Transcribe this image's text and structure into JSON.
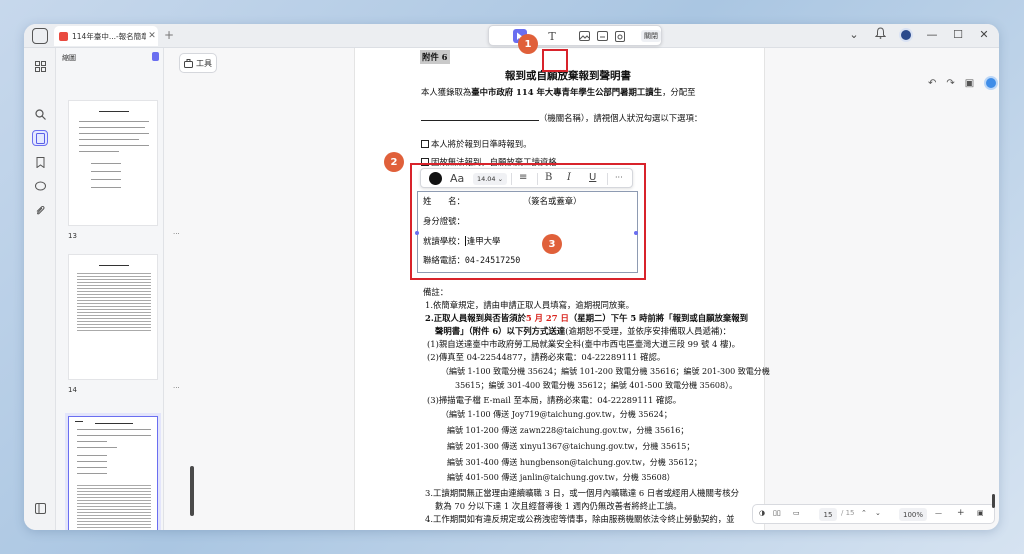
{
  "window": {
    "tab_title": "114年臺中...-報名簡章*",
    "tab_close": "✕",
    "tab_add": "+"
  },
  "titlebar_icons": [
    "chevron-down-icon",
    "bell-icon",
    "avatar",
    "minimize-icon",
    "maximize-icon",
    "close-icon"
  ],
  "titlebar_symbols": {
    "chevron": "⌄",
    "bell": "♪",
    "minimize": "—",
    "maximize": "☐",
    "close": "✕"
  },
  "left_rail": [
    "grid-icon",
    "search-icon",
    "page-edit-icon",
    "bookmark-icon",
    "comment-icon",
    "attachment-icon",
    "layers-icon"
  ],
  "thumbnails": {
    "header": "縮圖",
    "pages": [
      {
        "number": "13",
        "more": "···"
      },
      {
        "number": "14",
        "more": "···"
      },
      {
        "number": "15",
        "more": "···"
      }
    ]
  },
  "tools_button": {
    "label": "工具"
  },
  "edit_toolbar": {
    "close_label": "關閉",
    "text_tool": "T"
  },
  "format_bar": {
    "font_size": "14.04",
    "font_label": "Aa",
    "bold": "B",
    "italic": "I",
    "underline": "U",
    "more": "···"
  },
  "markers": [
    "1",
    "2",
    "3"
  ],
  "document": {
    "attachment": "附件 6",
    "title": "報到或自願放棄報到聲明書",
    "line1_a": "本人獲錄取為",
    "line1_b": "臺中市政府 114 年大專青年學生公部門暑期工讀生",
    "line1_c": "，分配至",
    "line2": "（機關名稱），請視個人狀況勾選以下選項：",
    "option1": "本人將於報到日準時報到。",
    "option2": "因故無法報到，自願放棄工讀資格",
    "form_name": "姓　　名：",
    "form_sign": "（簽名或蓋章）",
    "form_id": "身分證號：",
    "form_school_label": "就讀學校：",
    "form_school_value": "逢甲大學",
    "form_phone_label": "聯絡電話：",
    "form_phone_value": "04-24517250",
    "notes_title": "備註：",
    "note1": "1.依簡章規定，請由申請正取人員填寫，逾期視同放棄。",
    "note2_a": "2.",
    "note2_b": "正取人員報到與否皆須於",
    "note2_date": "5 月 27 日",
    "note2_c": "（星期二）下午 5 時前將「報到或自願放棄報到",
    "note2_d": "聲明書」（附件 6）以下列方式送達",
    "note2_e": "(逾期恕不受理，並依序安排備取人員遞補)：",
    "note2_1": "(1)親自送達臺中市政府勞工局就業安全科(臺中市西屯區臺灣大道三段 99 號 4 樓)。",
    "note2_2": "(2)傳真至 04-22544877，請務必來電：04-22289111 確認。",
    "note2_2a": "（編號 1-100 致電分機 35624；編號 101-200 致電分機 35616；編號 201-300 致電分機",
    "note2_2b": "35615；編號 301-400 致電分機 35612；編號 401-500 致電分機 35608）。",
    "note2_3": "(3)掃描電子檔 E-mail 至本局，請務必來電：04-22289111 確認。",
    "mail1": "（編號 1-100 傳送 Joy719@taichung.gov.tw，分機 35624；",
    "mail2": "編號 101-200 傳送 zawn228@taichung.gov.tw，分機 35616；",
    "mail3": "編號 201-300 傳送 xinyu1367@taichung.gov.tw，分機 35615；",
    "mail4": "編號 301-400 傳送 hungbenson@taichung.gov.tw，分機 35612；",
    "mail5": "編號 401-500 傳送 janlin@taichung.gov.tw，分機 35608）",
    "note3_a": "3.工讀期間無正當理由連續曠職 3 日，或一個月內曠職達 6 日者或經用人機關考核分",
    "note3_b": "數為 70 分以下達 1 次且經督導後 1 週內仍無改善者將終止工讀。",
    "note4": "4.工作期間如有違反規定或公務洩密等情事，除由服務機關依法令終止勞動契約，並"
  },
  "status_bar": {
    "page_current": "15",
    "page_total": "/ 15",
    "zoom": "100%",
    "zoom_out": "—",
    "zoom_in": "+"
  }
}
